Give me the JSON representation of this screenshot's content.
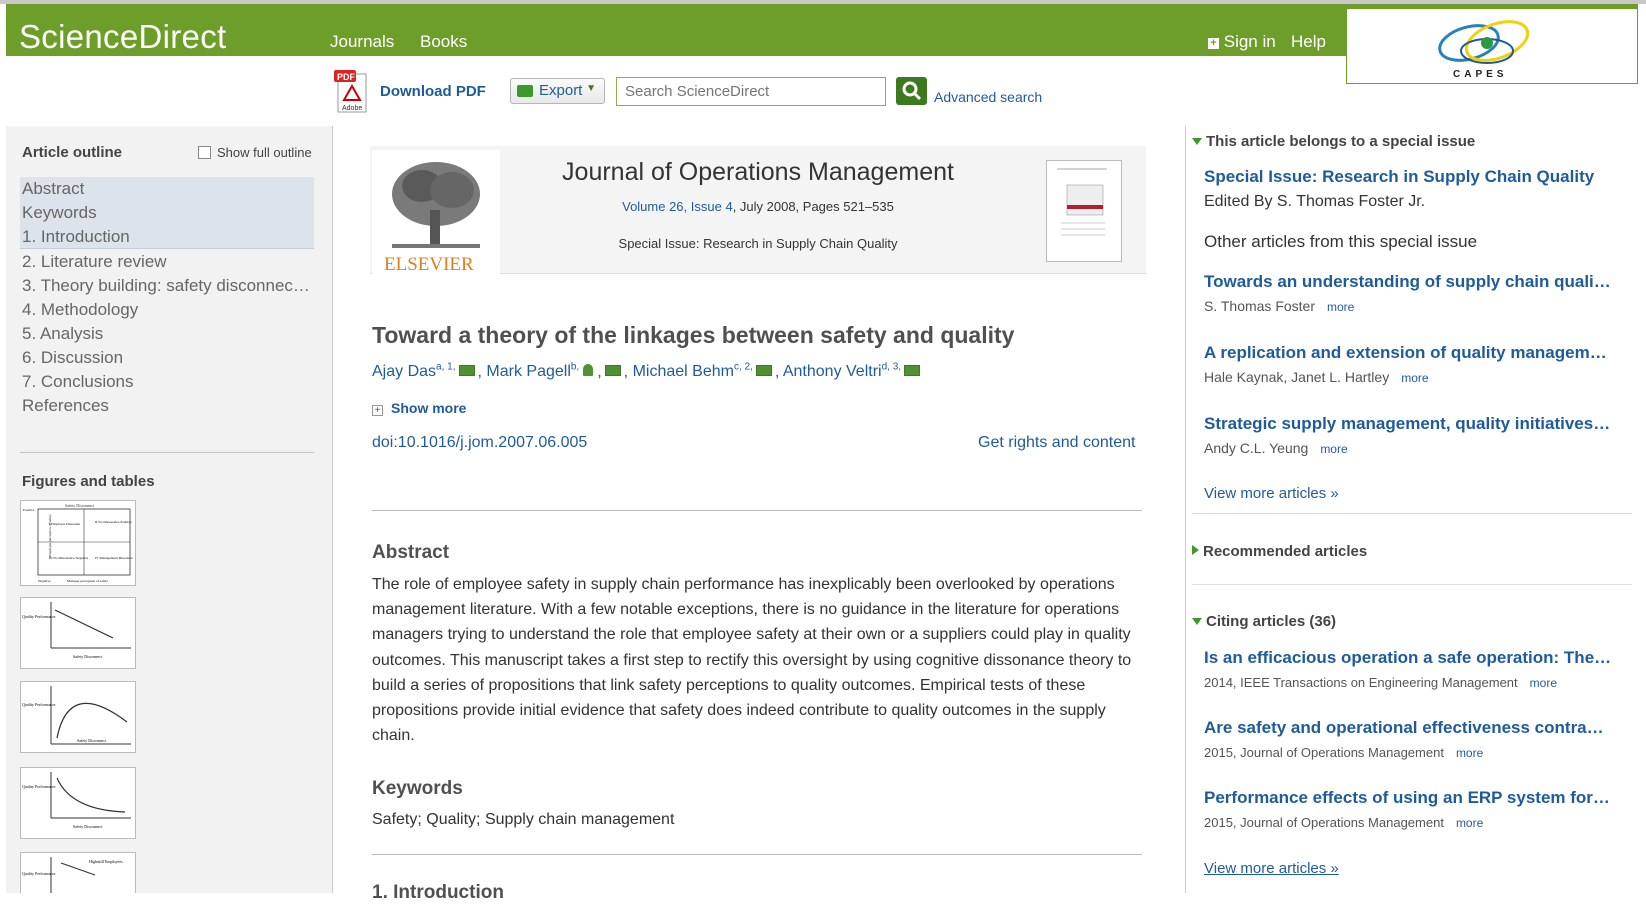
{
  "header": {
    "logo": "ScienceDirect",
    "nav": [
      "Journals",
      "Books"
    ],
    "sign_in": "Sign in",
    "help": "Help",
    "capes_label": "CAPES"
  },
  "toolbar": {
    "download_pdf": "Download PDF",
    "export": "Export",
    "search_placeholder": "Search ScienceDirect",
    "advanced_search": "Advanced search"
  },
  "outline": {
    "title": "Article outline",
    "show_full": "Show full outline",
    "items": [
      "Abstract",
      "Keywords",
      "1. Introduction",
      "2. Literature review",
      "3. Theory building: safety disconnect …",
      "4. Methodology",
      "5. Analysis",
      "6. Discussion",
      "7. Conclusions",
      "References"
    ],
    "figures_title": "Figures and tables"
  },
  "journal": {
    "publisher": "ELSEVIER",
    "title": "Journal of Operations Management",
    "volume_link": "Volume 26, Issue 4",
    "volume_rest": ", July 2008, Pages 521–535",
    "special": "Special Issue: Research in Supply Chain Quality"
  },
  "article": {
    "title": "Toward a theory of the linkages between safety and quality",
    "authors": [
      {
        "name": "Ajay Das",
        "sup": "a, 1,"
      },
      {
        "name": "Mark Pagell",
        "sup": "b,"
      },
      {
        "name": "Michael Behm",
        "sup": "c, 2,"
      },
      {
        "name": "Anthony Veltri",
        "sup": "d, 3,"
      }
    ],
    "show_more": "Show more",
    "doi": "doi:10.1016/j.jom.2007.06.005",
    "rights": "Get rights and content",
    "abstract_heading": "Abstract",
    "abstract": "The role of employee safety in supply chain performance has inexplicably been overlooked by operations management literature. With a few notable exceptions, there is no guidance in the literature for operations managers trying to understand the role that employee safety at their own or a suppliers could play in quality outcomes. This manuscript takes a first step to rectify this oversight by using cognitive dissonance theory to build a series of propositions that link safety perceptions to quality outcomes. Empirical tests of these propositions provide initial evidence that safety does indeed contribute to quality outcomes in the supply chain.",
    "keywords_heading": "Keywords",
    "keywords": "Safety; Quality; Supply chain management",
    "next_section": "1. Introduction"
  },
  "sidebar": {
    "special_heading": "This article belongs to a special issue",
    "special_title": "Special Issue: Research in Supply Chain Quality",
    "special_editor": "Edited By S. Thomas Foster Jr.",
    "other_heading": "Other articles from this special issue",
    "more": "more",
    "other_articles": [
      {
        "title": "Towards an understanding of supply chain quality …",
        "meta": "S. Thomas Foster"
      },
      {
        "title": "A replication and extension of quality management …",
        "meta": "Hale Kaynak, Janet L. Hartley"
      },
      {
        "title": "Strategic supply management, quality initiatives, an…",
        "meta": "Andy C.L. Yeung"
      }
    ],
    "view_more": "View more articles »",
    "recommended_heading": "Recommended articles",
    "citing_heading": "Citing articles (36)",
    "citing_articles": [
      {
        "title": "Is an efficacious operation a safe operation: The rol…",
        "meta": "2014, IEEE Transactions on Engineering Management"
      },
      {
        "title": "Are safety and operational effectiveness contradict…",
        "meta": "2015, Journal of Operations Management"
      },
      {
        "title": "Performance effects of using an ERP system for m…",
        "meta": "2015, Journal of Operations Management"
      }
    ],
    "view_more_citing": "View more articles »"
  },
  "figures": {
    "thumb1": {
      "top": "Safety Disconnect",
      "q1": "I Employee Dissonant",
      "q2": "II No Dissonance Positive",
      "q3": "III No Dissonance Negative",
      "q4": "IV Management Dissonant",
      "yaxis": "Employee perception of safety",
      "pos": "Positive",
      "neg": "Negative",
      "xaxis": "Manager perception of safety"
    },
    "ylabel": "Quality Performance",
    "xlabel": "Safety Disconnect",
    "thumb5": "Highskill Employees"
  },
  "colors": {
    "brand_green": "#6e9e2a",
    "link_blue": "#1f5b9c"
  }
}
